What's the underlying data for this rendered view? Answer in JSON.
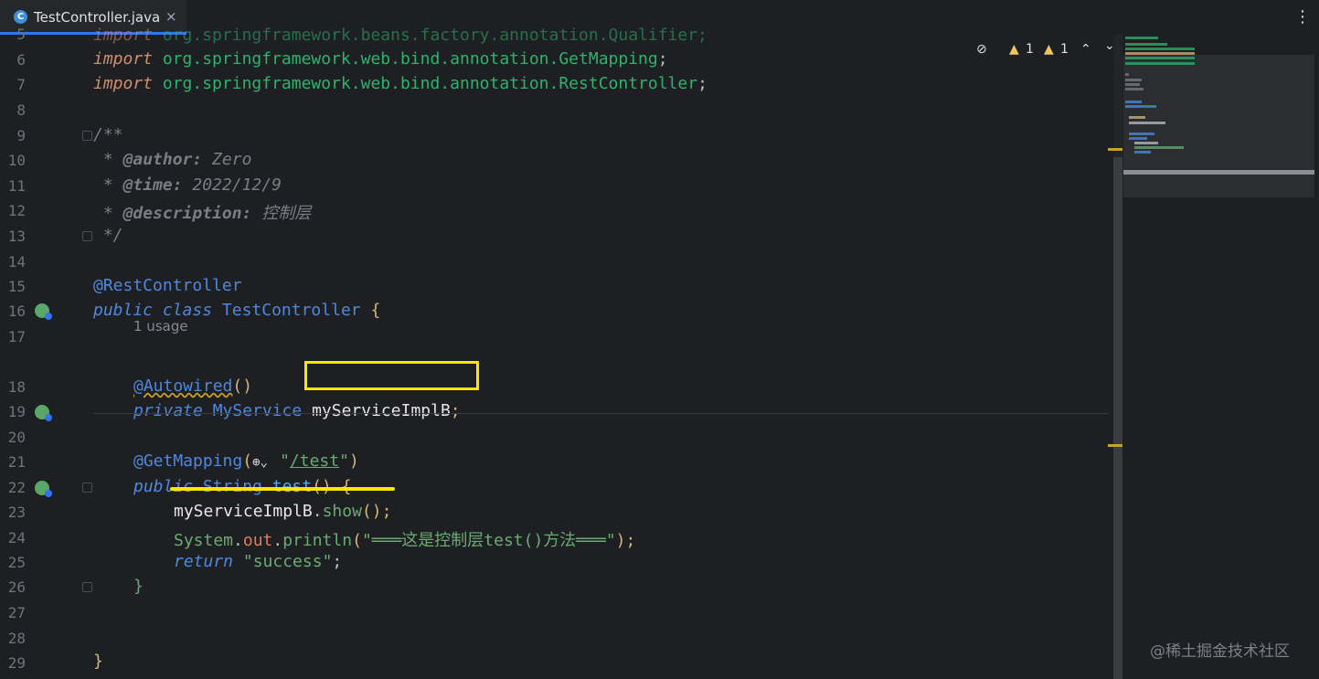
{
  "tab": {
    "icon_letter": "C",
    "label": "TestController.java",
    "close": "×"
  },
  "more_menu": "⋮",
  "inspections": {
    "hide_icon": "eye-off-icon",
    "warnings_a": "1",
    "warnings_b": "1",
    "up": "⌃",
    "down": "⌄"
  },
  "line_numbers": [
    "5",
    "6",
    "7",
    "8",
    "9",
    "10",
    "11",
    "12",
    "13",
    "14",
    "15",
    "16",
    "17",
    "18",
    "19",
    "20",
    "21",
    "22",
    "23",
    "24",
    "25",
    "26",
    "27",
    "28",
    "29"
  ],
  "code": {
    "l5_kw": "import",
    "l5_rest": " org.springframework.beans.factory.annotation.Qualifier;",
    "l6_kw": "import",
    "l6_pkg": " org.springframework.web.bind.annotation.GetMapping",
    "l6_end": ";",
    "l7_kw": "import",
    "l7_pkg": " org.springframework.web.bind.annotation.RestController",
    "l7_end": ";",
    "l9": "/**",
    "l10_pre": " * ",
    "l10_tag": "@author:",
    "l10_val": " Zero",
    "l11_pre": " * ",
    "l11_tag": "@time:",
    "l11_val": " 2022/12/9",
    "l12_pre": " * ",
    "l12_tag": "@description:",
    "l12_val": " 控制层",
    "l13": " */",
    "l15": "@RestController",
    "l16_a": "public",
    "l16_b": " class",
    "l16_c": " TestController ",
    "l16_d": "{",
    "usage": "1 usage",
    "l18_a": "@Autowired",
    "l18_b": "()",
    "l19_a": "private",
    "l19_b": " MyService ",
    "l19_c": "myServiceImplB",
    "l19_d": ";",
    "l21_a": "@GetMapping",
    "l21_b": "(",
    "l21_c": "\"",
    "l21_d": "/test",
    "l21_e": "\"",
    "l21_f": ")",
    "l22_a": "public",
    "l22_b": " String ",
    "l22_c": "test",
    "l22_d": "() ",
    "l22_e": "{",
    "l23_a": "myServiceImplB",
    "l23_b": ".",
    "l23_c": "show",
    "l23_d": "();",
    "l24_a": "System",
    "l24_b": ".",
    "l24_c": "out",
    "l24_d": ".",
    "l24_e": "println",
    "l24_f": "(",
    "l24_g": "\"═══这是控制层test()方法═══\"",
    "l24_h": ");",
    "l25_a": "return",
    "l25_b": " \"success\"",
    "l25_c": ";",
    "l26": "}",
    "l29": "}"
  },
  "watermark": "@稀土掘金技术社区",
  "colors": {
    "accent": "#3574f0",
    "highlight": "#ffe600",
    "background": "#1e1f22"
  }
}
